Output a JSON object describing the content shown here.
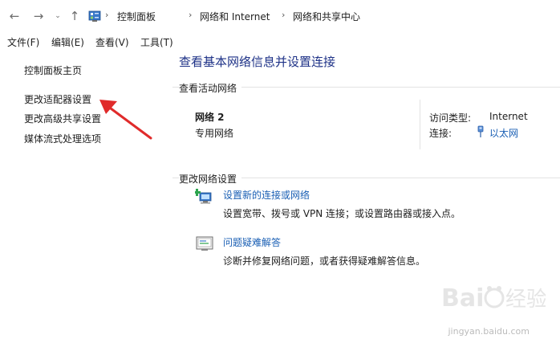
{
  "breadcrumb": [
    "控制面板",
    "网络和 Internet",
    "网络和共享中心"
  ],
  "menu": [
    "文件(F)",
    "编辑(E)",
    "查看(V)",
    "工具(T)"
  ],
  "left_pane": {
    "items": [
      "控制面板主页",
      "更改适配器设置",
      "更改高级共享设置",
      "媒体流式处理选项"
    ]
  },
  "main": {
    "title": "查看基本网络信息并设置连接",
    "active_networks_label": "查看活动网络",
    "network_name": "网络 2",
    "network_type": "专用网络",
    "access_type_label": "访问类型:",
    "access_type_value": "Internet",
    "connections_label": "连接:",
    "connections_value": "以太网",
    "change_settings_label": "更改网络设置",
    "tasks": [
      {
        "link": "设置新的连接或网络",
        "desc": "设置宽带、拨号或 VPN 连接；或设置路由器或接入点。",
        "icon": "new-connection-icon"
      },
      {
        "link": "问题疑难解答",
        "desc": "诊断并修复网络问题，或者获得疑难解答信息。",
        "icon": "troubleshoot-icon"
      }
    ]
  },
  "watermark": {
    "text": "jingyan.baidu.com"
  }
}
